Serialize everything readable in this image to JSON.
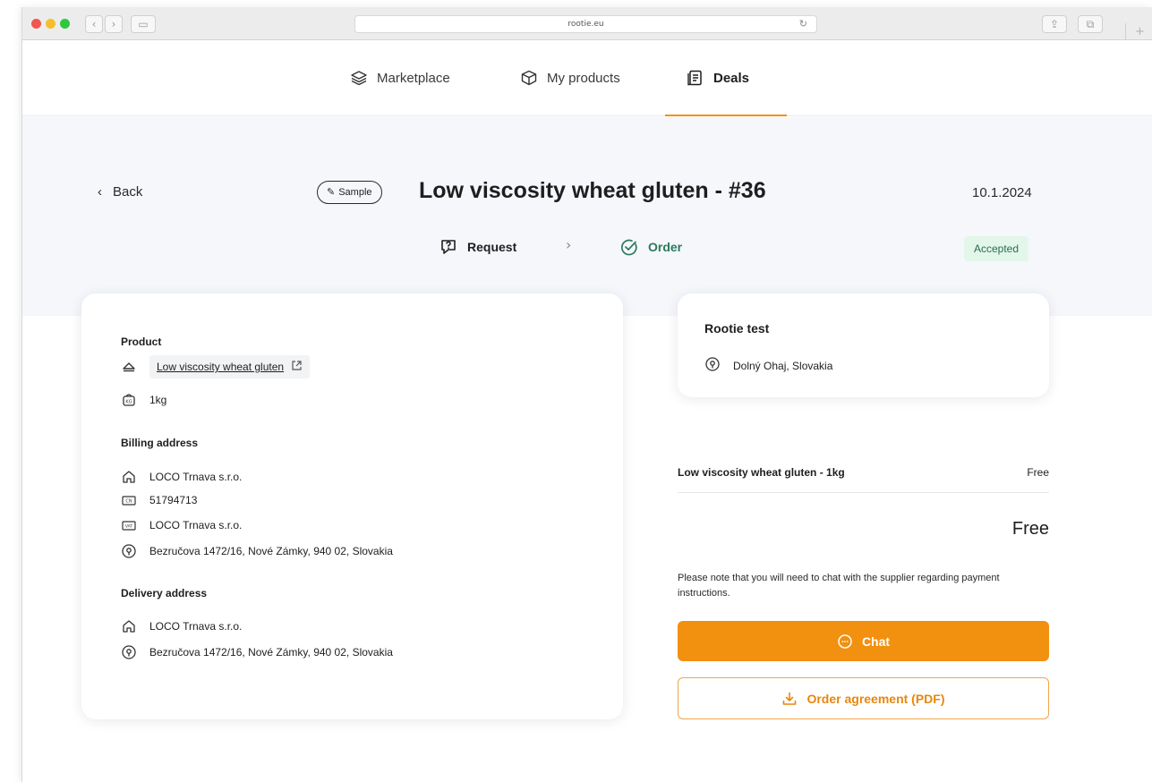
{
  "browser": {
    "url": "rootie.eu",
    "back_icon": "chevron-left-icon",
    "forward_icon": "chevron-right-icon",
    "sidebar_icon": "sidebar-icon",
    "share_icon": "share-icon",
    "tabs_icon": "tabs-icon",
    "new_tab_icon": "plus-icon"
  },
  "nav": {
    "items": [
      {
        "label": "Marketplace",
        "icon": "layers-icon"
      },
      {
        "label": "My products",
        "icon": "box-icon"
      },
      {
        "label": "Deals",
        "icon": "document-icon"
      }
    ],
    "active": "Deals"
  },
  "header": {
    "back_label": "Back",
    "tag_label": "Sample",
    "title": "Low viscosity wheat gluten - #36",
    "date": "10.1.2024",
    "steps": [
      {
        "label": "Request",
        "icon": "question-bubble-icon"
      },
      {
        "label": "Order",
        "icon": "check-circle-icon"
      }
    ],
    "status": "Accepted"
  },
  "details": {
    "product_label": "Product",
    "product_name": "Low viscosity wheat gluten",
    "quantity": "1kg",
    "billing_label": "Billing address",
    "billing": {
      "company": "LOCO Trnava s.r.o.",
      "cin": "51794713",
      "vat": "LOCO Trnava s.r.o.",
      "address": "Bezručova 1472/16, Nové Zámky, 940 02, Slovakia"
    },
    "delivery_label": "Delivery address",
    "delivery": {
      "company": "LOCO Trnava s.r.o.",
      "address": "Bezručova 1472/16, Nové Zámky, 940 02, Slovakia"
    }
  },
  "seller": {
    "name": "Rootie test",
    "location": "Dolný Ohaj, Slovakia"
  },
  "summary": {
    "line_label": "Low viscosity wheat gluten - 1kg",
    "line_price": "Free",
    "total": "Free",
    "note": "Please note that you will need to chat with the supplier regarding payment instructions.",
    "chat_label": "Chat",
    "pdf_label": "Order agreement (PDF)"
  },
  "colors": {
    "accent": "#f2900f",
    "success_text": "#2a7a5c",
    "success_bg": "#e3f6ea",
    "hero_bg": "#f5f7fb"
  }
}
